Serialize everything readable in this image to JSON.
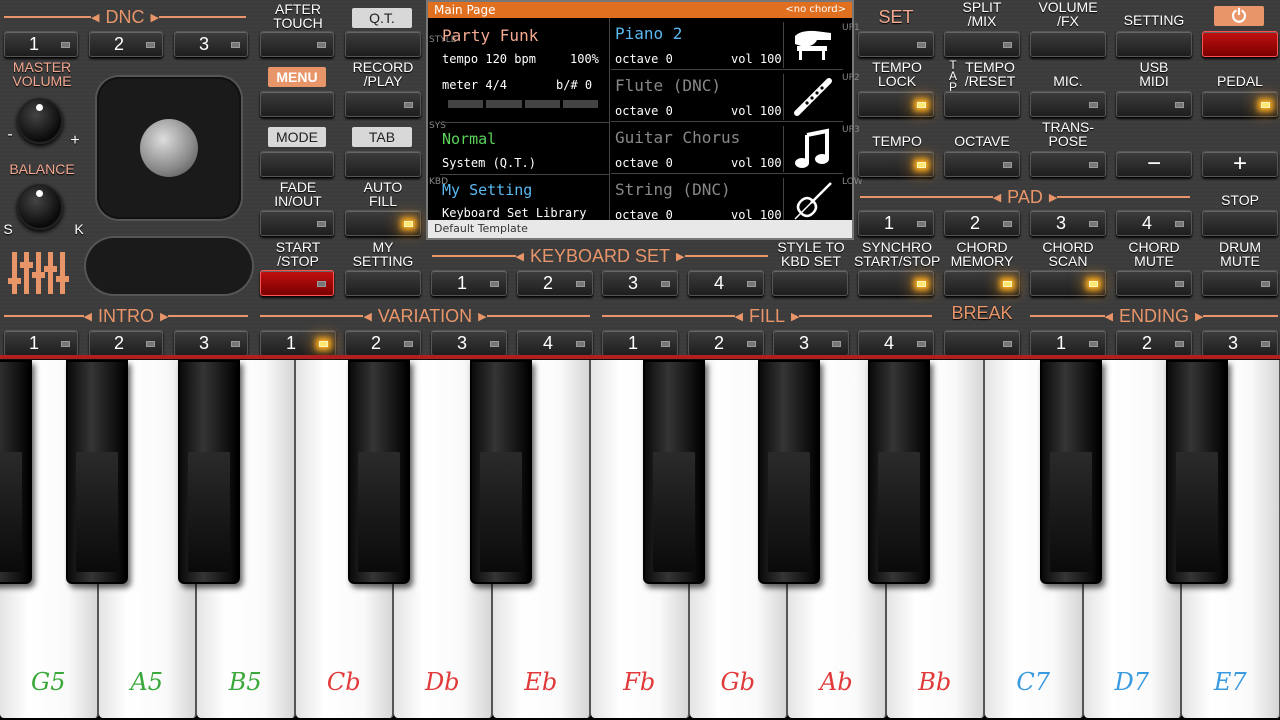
{
  "dnc": {
    "title": "DNC",
    "buttons": [
      "1",
      "2",
      "3"
    ]
  },
  "after_touch": "AFTER\nTOUCH",
  "qt": "Q.T.",
  "master_volume": {
    "label": "MASTER\nVOLUME",
    "min": "-",
    "max": "+"
  },
  "balance": {
    "label": "BALANCE",
    "left": "S",
    "right": "K"
  },
  "menu": "MENU",
  "record_play": "RECORD\n/PLAY",
  "mode": "MODE",
  "tab": "TAB",
  "fade": "FADE\nIN/OUT",
  "auto_fill": "AUTO\nFILL",
  "start_stop": "START\n/STOP",
  "my_setting": "MY\nSETTING",
  "screen": {
    "header": "Main Page",
    "chord": "<no chord>",
    "style": {
      "name": "Party Funk",
      "tempo": "tempo 120 bpm",
      "percent": "100%",
      "meter": "meter 4/4",
      "transpose": "b/#  0",
      "mode": "Normal",
      "system": "System (Q.T.)",
      "setting": "My Setting",
      "library": "Keyboard Set Library"
    },
    "parts": [
      {
        "name": "Piano 2",
        "octave": "octave  0",
        "vol": "vol 100",
        "active": true,
        "icon": "piano-icon"
      },
      {
        "name": "Flute (DNC)",
        "octave": "octave  0",
        "vol": "vol 100",
        "active": false,
        "icon": "flute-icon"
      },
      {
        "name": "Guitar Chorus",
        "octave": "octave  0",
        "vol": "vol 100",
        "active": false,
        "icon": "music-note-icon"
      },
      {
        "name": "String (DNC)",
        "octave": "octave  0",
        "vol": "vol 100",
        "active": false,
        "icon": "violin-icon"
      }
    ],
    "side_left": [
      "STYLE",
      "SYS",
      "KBD"
    ],
    "side_right": [
      "UP1",
      "UP2",
      "UP3",
      "LOW"
    ],
    "footer": "Default Template"
  },
  "right": {
    "set": "SET",
    "split_mix": "SPLIT\n/MIX",
    "volume_fx": "VOLUME\n/FX",
    "setting": "SETTING",
    "power": "⏻",
    "tempo_lock": "TEMPO\nLOCK",
    "tap": "TAP",
    "tempo_reset": "TEMPO\n/RESET",
    "mic": "MIC.",
    "usb_midi": "USB\nMIDI",
    "pedal": "PEDAL",
    "tempo": "TEMPO",
    "octave": "OCTAVE",
    "transpose": "TRANS-\nPOSE",
    "minus": "−",
    "plus": "+",
    "pad": "PAD",
    "pad_buttons": [
      "1",
      "2",
      "3",
      "4"
    ],
    "stop": "STOP"
  },
  "keyboard_set": {
    "title": "KEYBOARD SET",
    "buttons": [
      "1",
      "2",
      "3",
      "4"
    ]
  },
  "row3": {
    "style_to_kbd": "STYLE TO\nKBD SET",
    "synchro": "SYNCHRO\nSTART/STOP",
    "chord_memory": "CHORD\nMEMORY",
    "chord_scan": "CHORD\nSCAN",
    "chord_mute": "CHORD\nMUTE",
    "drum_mute": "DRUM\nMUTE"
  },
  "intro": {
    "title": "INTRO",
    "buttons": [
      "1",
      "2",
      "3"
    ]
  },
  "variation": {
    "title": "VARIATION",
    "buttons": [
      "1",
      "2",
      "3",
      "4"
    ]
  },
  "fill": {
    "title": "FILL",
    "buttons": [
      "1",
      "2",
      "3",
      "4"
    ]
  },
  "break": "BREAK",
  "ending": {
    "title": "ENDING",
    "buttons": [
      "1",
      "2",
      "3"
    ]
  },
  "keys": [
    {
      "name": "G5",
      "color": "#3aa83a"
    },
    {
      "name": "A5",
      "color": "#3aa83a"
    },
    {
      "name": "B5",
      "color": "#3aa83a"
    },
    {
      "name": "Cb",
      "color": "#e03a3a"
    },
    {
      "name": "Db",
      "color": "#e03a3a"
    },
    {
      "name": "Eb",
      "color": "#e03a3a"
    },
    {
      "name": "Fb",
      "color": "#e03a3a"
    },
    {
      "name": "Gb",
      "color": "#e03a3a"
    },
    {
      "name": "Ab",
      "color": "#e03a3a"
    },
    {
      "name": "Bb",
      "color": "#e03a3a"
    },
    {
      "name": "C7",
      "color": "#3a9ae0"
    },
    {
      "name": "D7",
      "color": "#3a9ae0"
    },
    {
      "name": "E7",
      "color": "#3a9ae0"
    }
  ]
}
